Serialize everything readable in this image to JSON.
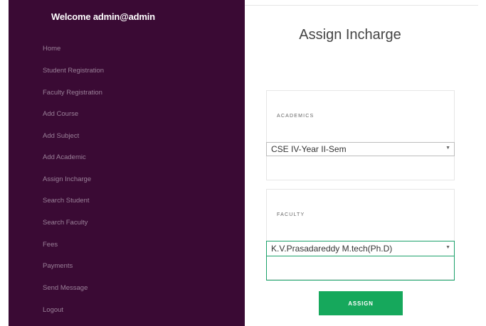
{
  "sidebar": {
    "welcome": "Welcome admin@admin",
    "items": [
      {
        "label": "Home"
      },
      {
        "label": "Student Registration"
      },
      {
        "label": "Faculty Registration"
      },
      {
        "label": "Add Course"
      },
      {
        "label": "Add Subject"
      },
      {
        "label": "Add Academic"
      },
      {
        "label": "Assign Incharge"
      },
      {
        "label": "Search Student"
      },
      {
        "label": "Search Faculty"
      },
      {
        "label": "Fees"
      },
      {
        "label": "Payments"
      },
      {
        "label": "Send Message"
      },
      {
        "label": "Logout"
      }
    ]
  },
  "main": {
    "title": "Assign Incharge",
    "academics": {
      "label": "ACADEMICS",
      "selected": "CSE IV-Year II-Sem"
    },
    "faculty": {
      "label": "FACULTY",
      "selected": "K.V.Prasadareddy M.tech(Ph.D)"
    },
    "assign_label": "ASSIGN"
  },
  "colors": {
    "sidebar_bg": "#3a0a34",
    "accent": "#16a85c"
  }
}
